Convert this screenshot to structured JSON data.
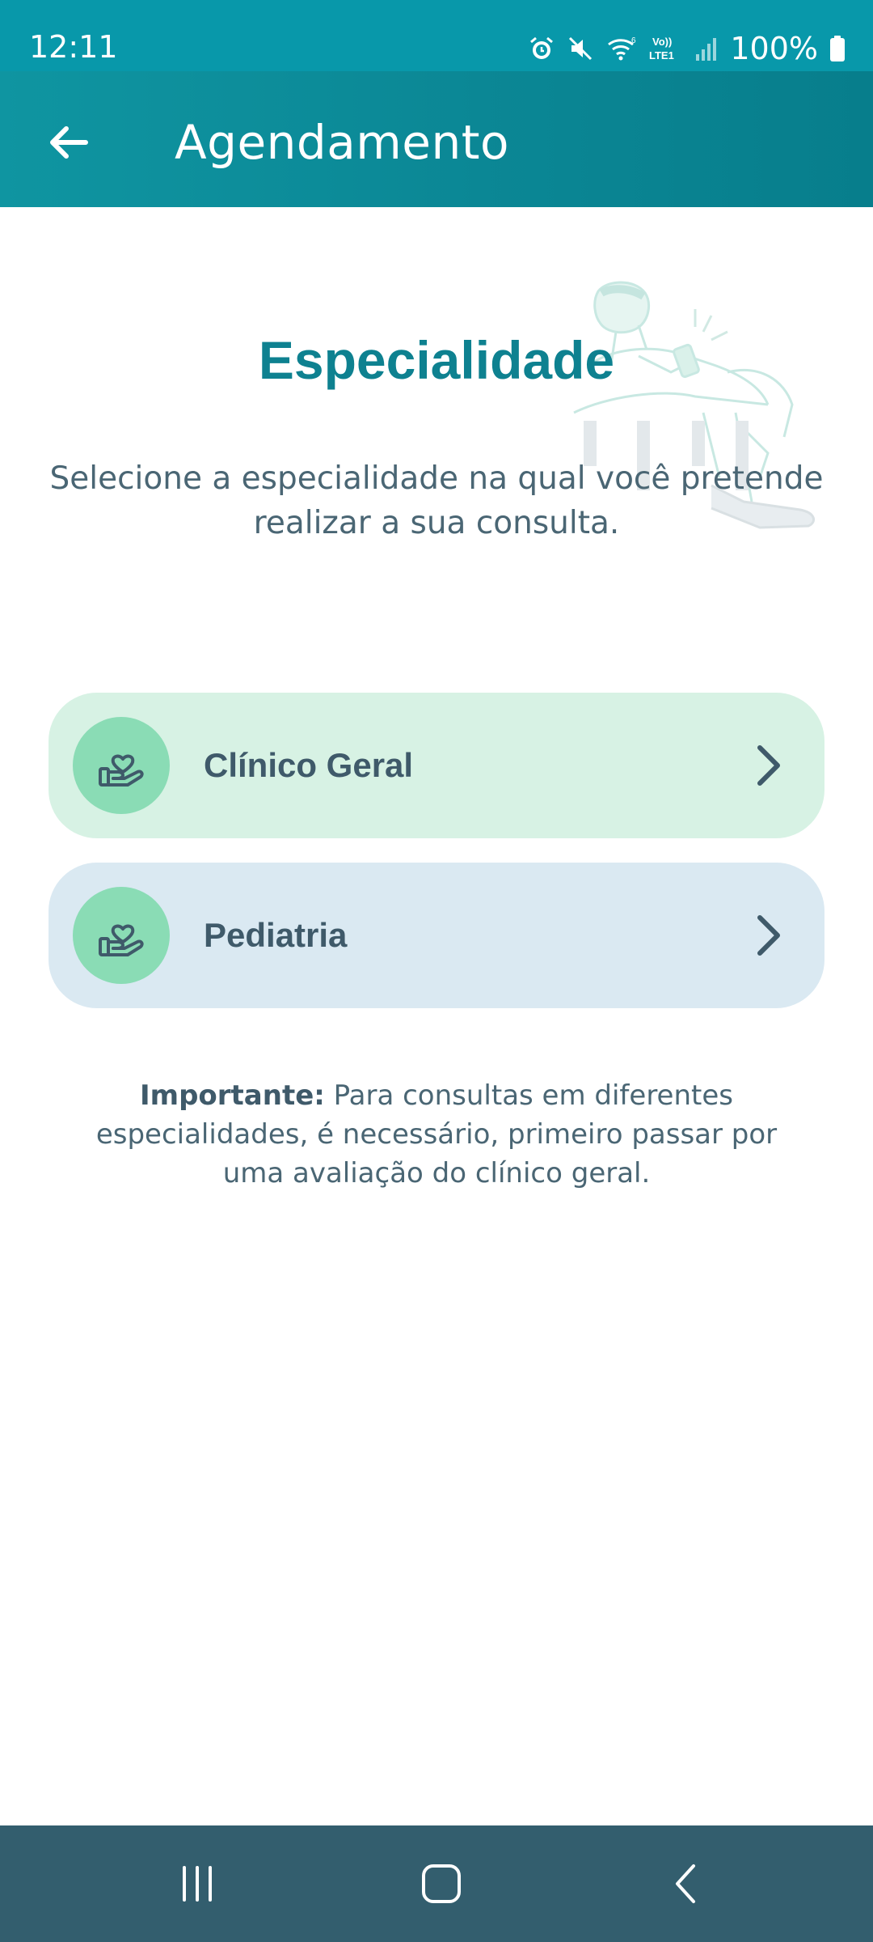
{
  "status_bar": {
    "time": "12:11",
    "battery": "100%",
    "icons": [
      "alarm-icon",
      "mute-icon",
      "wifi-icon",
      "volte-icon",
      "signal-icon",
      "battery-icon"
    ]
  },
  "app_bar": {
    "title": "Agendamento",
    "back_icon": "arrow-left-icon"
  },
  "content": {
    "title": "Especialidade",
    "subtitle": "Selecione a especialidade na qual você pretende realizar a sua consulta.",
    "specialties": [
      {
        "label": "Clínico Geral",
        "icon": "hand-heart-icon",
        "background": "#d7f2e4"
      },
      {
        "label": "Pediatria",
        "icon": "hand-heart-icon",
        "background": "#dae9f2"
      }
    ],
    "note": {
      "bold": "Importante:",
      "text": " Para consultas em diferentes especialidades, é necessário, primeiro passar por uma avaliação do clínico geral."
    }
  },
  "colors": {
    "primary": "#0b8795",
    "title": "#0e8190",
    "text": "#4a6674",
    "icon_circle": "#8adcb5",
    "nav_bar": "#335e6e"
  },
  "nav_bar": {
    "buttons": [
      "recent-apps-icon",
      "home-icon",
      "back-icon"
    ]
  }
}
